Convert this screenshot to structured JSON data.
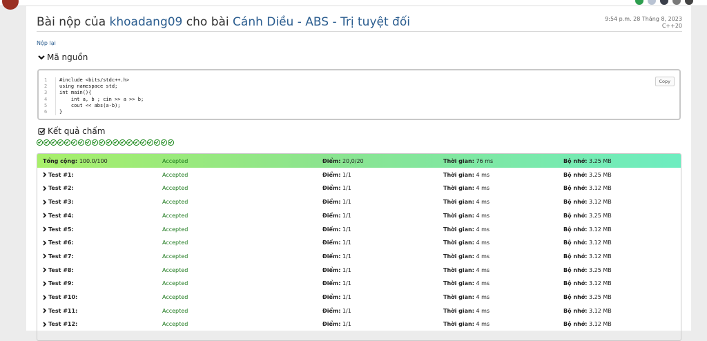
{
  "page": {
    "title_prefix": "Bài nộp của",
    "user": "khoadang09",
    "title_mid": "cho bài",
    "problem": "Cánh Diều - ABS - Trị tuyệt đối",
    "submitted_time": "9:54 p.m. 28 Tháng 8, 2023",
    "language": "C++20",
    "resubmit_label": "Nộp lại"
  },
  "source": {
    "heading": "Mã nguồn",
    "copy_label": "Copy",
    "line_numbers": [
      "1",
      "2",
      "3",
      "4",
      "5",
      "6"
    ],
    "code": "#include <bits/stdc++.h>\nusing namespace std;\nint main(){\n    int a, b ; cin >> a >> b;\n    cout << abs(a-b);\n}"
  },
  "results": {
    "heading": "Kết quả chấm",
    "check_count": 20,
    "labels": {
      "points": "Điểm:",
      "time": "Thời gian:",
      "memory": "Bộ nhớ:"
    },
    "total": {
      "name": "Tổng cộng:",
      "score": "100.0/100",
      "status": "Accepted",
      "points": "20,0/20",
      "time": "76 ms",
      "memory": "3.25 MB"
    },
    "tests": [
      {
        "name": "Test #1:",
        "status": "Accepted",
        "points": "1/1",
        "time": "4 ms",
        "memory": "3.25 MB"
      },
      {
        "name": "Test #2:",
        "status": "Accepted",
        "points": "1/1",
        "time": "4 ms",
        "memory": "3.12 MB"
      },
      {
        "name": "Test #3:",
        "status": "Accepted",
        "points": "1/1",
        "time": "4 ms",
        "memory": "3.12 MB"
      },
      {
        "name": "Test #4:",
        "status": "Accepted",
        "points": "1/1",
        "time": "4 ms",
        "memory": "3.25 MB"
      },
      {
        "name": "Test #5:",
        "status": "Accepted",
        "points": "1/1",
        "time": "4 ms",
        "memory": "3.12 MB"
      },
      {
        "name": "Test #6:",
        "status": "Accepted",
        "points": "1/1",
        "time": "4 ms",
        "memory": "3.12 MB"
      },
      {
        "name": "Test #7:",
        "status": "Accepted",
        "points": "1/1",
        "time": "4 ms",
        "memory": "3.12 MB"
      },
      {
        "name": "Test #8:",
        "status": "Accepted",
        "points": "1/1",
        "time": "4 ms",
        "memory": "3.25 MB"
      },
      {
        "name": "Test #9:",
        "status": "Accepted",
        "points": "1/1",
        "time": "4 ms",
        "memory": "3.12 MB"
      },
      {
        "name": "Test #10:",
        "status": "Accepted",
        "points": "1/1",
        "time": "4 ms",
        "memory": "3.25 MB"
      },
      {
        "name": "Test #11:",
        "status": "Accepted",
        "points": "1/1",
        "time": "4 ms",
        "memory": "3.12 MB"
      },
      {
        "name": "Test #12:",
        "status": "Accepted",
        "points": "1/1",
        "time": "4 ms",
        "memory": "3.12 MB"
      }
    ]
  },
  "colors": {
    "link": "#2b5d8f",
    "accepted": "#1e7a1e",
    "check": "#1e8a1e"
  }
}
